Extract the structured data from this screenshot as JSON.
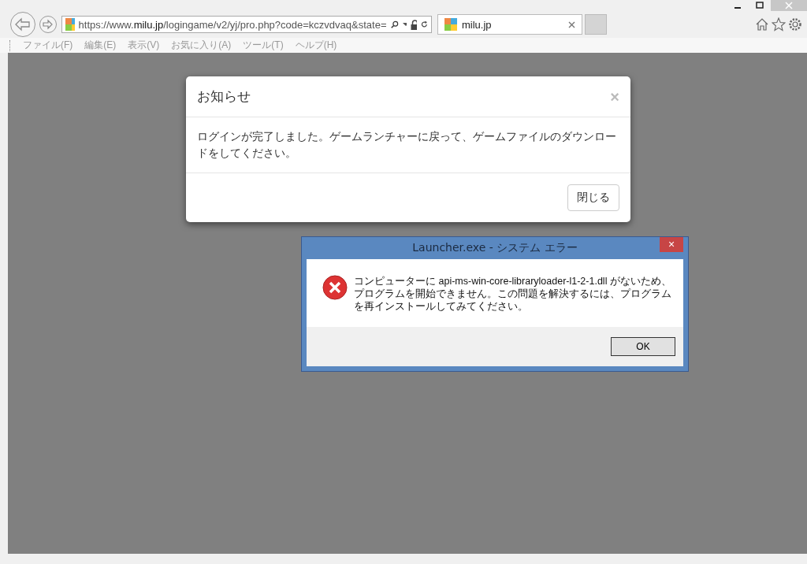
{
  "browser": {
    "address": {
      "before": "https://www.",
      "domain": "milu.jp",
      "after": "/logingame/v2/yj/pro.php?code=kczvdvaq&state="
    },
    "tabs": [
      {
        "label": "milu.jp",
        "selected": true
      }
    ],
    "menu": [
      "ファイル(F)",
      "編集(E)",
      "表示(V)",
      "お気に入り(A)",
      "ツール(T)",
      "ヘルプ(H)"
    ]
  },
  "notice_dialog": {
    "title": "お知らせ",
    "close_glyph": "×",
    "message": "ログインが完了しました。ゲームランチャーに戻って、ゲームファイルのダウンロードをしてください。",
    "button": "閉じる"
  },
  "error_dialog": {
    "title": "Launcher.exe - システム エラー",
    "close_glyph": "×",
    "message": "コンピューターに api-ms-win-core-libraryloader-l1-2-1.dll がないため、プログラムを開始できません。この問題を解決するには、プログラムを再インストールしてみてください。",
    "button": "OK"
  }
}
